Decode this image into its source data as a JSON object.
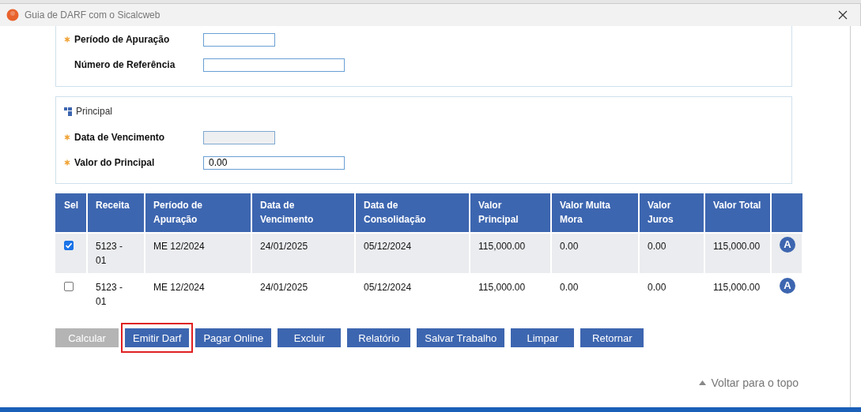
{
  "window": {
    "title": "Guia de DARF com o Sicalcweb"
  },
  "section_1": {
    "fields": [
      {
        "label": "Período de Apuração",
        "required": true,
        "disabled": false
      },
      {
        "label": "Número de Referência",
        "required": false,
        "disabled": false
      }
    ]
  },
  "section_2": {
    "title": "Principal",
    "fields": [
      {
        "label": "Data de Vencimento",
        "required": true,
        "disabled": true
      },
      {
        "label": "Valor do Principal",
        "required": true,
        "disabled": false,
        "value": "0.00"
      }
    ]
  },
  "table": {
    "columns": [
      "Sel",
      "Receita",
      "Período de Apuração",
      "Data de Vencimento",
      "Data de Consolidação",
      "Valor Principal",
      "Valor Multa Mora",
      "Valor Juros",
      "Valor Total"
    ],
    "rows": [
      {
        "checked": true,
        "cells": [
          "",
          "5123 - 01",
          "ME 12/2024",
          "24/01/2025",
          "05/12/2024",
          "115,000.00",
          "0.00",
          "0.00",
          "115,000.00"
        ],
        "badge": "A"
      },
      {
        "checked": false,
        "cells": [
          "",
          "5123 - 01",
          "ME 12/2024",
          "24/01/2025",
          "05/12/2024",
          "115,000.00",
          "0.00",
          "0.00",
          "115,000.00"
        ],
        "badge": "A"
      }
    ]
  },
  "buttons": [
    {
      "label": "Calcular",
      "disabled": true,
      "highlighted": false
    },
    {
      "label": "Emitir Darf",
      "disabled": false,
      "highlighted": true
    },
    {
      "label": "Pagar Online",
      "disabled": false,
      "highlighted": false
    },
    {
      "label": "Excluir",
      "disabled": false,
      "highlighted": false
    },
    {
      "label": "Relatório",
      "disabled": false,
      "highlighted": false
    },
    {
      "label": "Salvar Trabalho",
      "disabled": false,
      "highlighted": false
    },
    {
      "label": "Limpar",
      "disabled": false,
      "highlighted": false
    },
    {
      "label": "Retornar",
      "disabled": false,
      "highlighted": false
    }
  ],
  "back_to_top": "Voltar para o topo"
}
